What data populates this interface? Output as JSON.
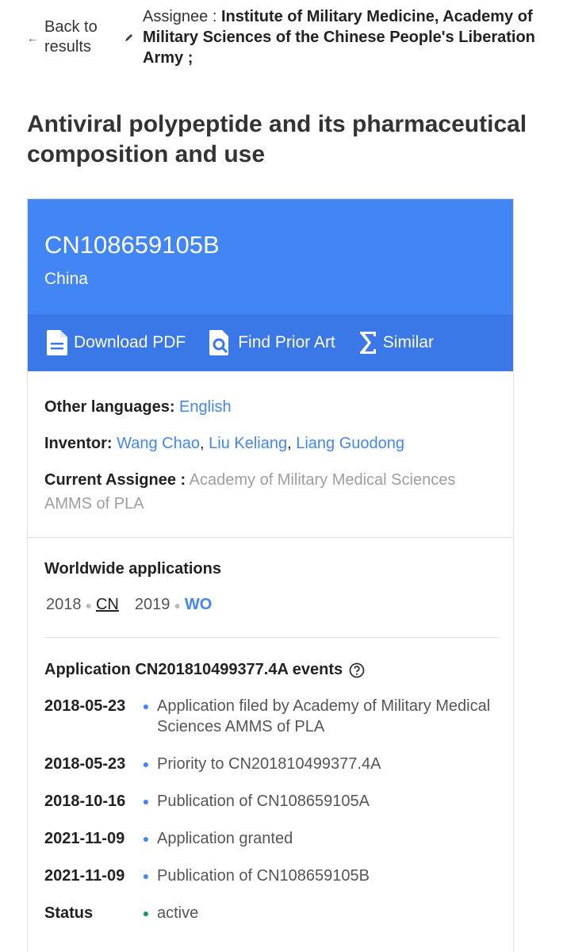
{
  "nav": {
    "back_label": "Back to results",
    "assignee_label": "Assignee : ",
    "assignee_value": "Institute of Military Medicine, Academy of Military Sciences of the Chinese People's Liberation Army ;"
  },
  "title": "Antiviral polypeptide and its pharmaceutical composition and use",
  "patent": {
    "number": "CN108659105B",
    "country": "China"
  },
  "actions": {
    "download": "Download PDF",
    "prior_art": "Find Prior Art",
    "similar": "Similar"
  },
  "meta": {
    "other_languages_label": "Other languages:",
    "other_languages_value": "English",
    "inventor_label": "Inventor:",
    "inventors": [
      "Wang Chao",
      "Liu Keliang",
      "Liang Guodong"
    ],
    "current_assignee_label": "Current Assignee :",
    "current_assignee_value": "Academy of Military Medical Sciences AMMS of PLA"
  },
  "worldwide": {
    "title": "Worldwide applications",
    "entries": [
      {
        "year": "2018",
        "code": "CN"
      },
      {
        "year": "2019",
        "code": "WO"
      }
    ]
  },
  "events": {
    "title": "Application CN201810499377.4A events",
    "items": [
      {
        "date": "2018-05-23",
        "text": "Application filed by Academy of Military Medical Sciences AMMS of PLA"
      },
      {
        "date": "2018-05-23",
        "text": "Priority to CN201810499377.4A"
      },
      {
        "date": "2018-10-16",
        "text": "Publication of CN108659105A"
      },
      {
        "date": "2021-11-09",
        "text": "Application granted"
      },
      {
        "date": "2021-11-09",
        "text": "Publication of CN108659105B"
      }
    ],
    "status_label": "Status",
    "status_value": "active"
  },
  "colors": {
    "header_blue": "#4285f4",
    "action_bar_blue": "#3b78e7",
    "link_blue": "#4285f4",
    "status_green": "#0f9d58"
  }
}
